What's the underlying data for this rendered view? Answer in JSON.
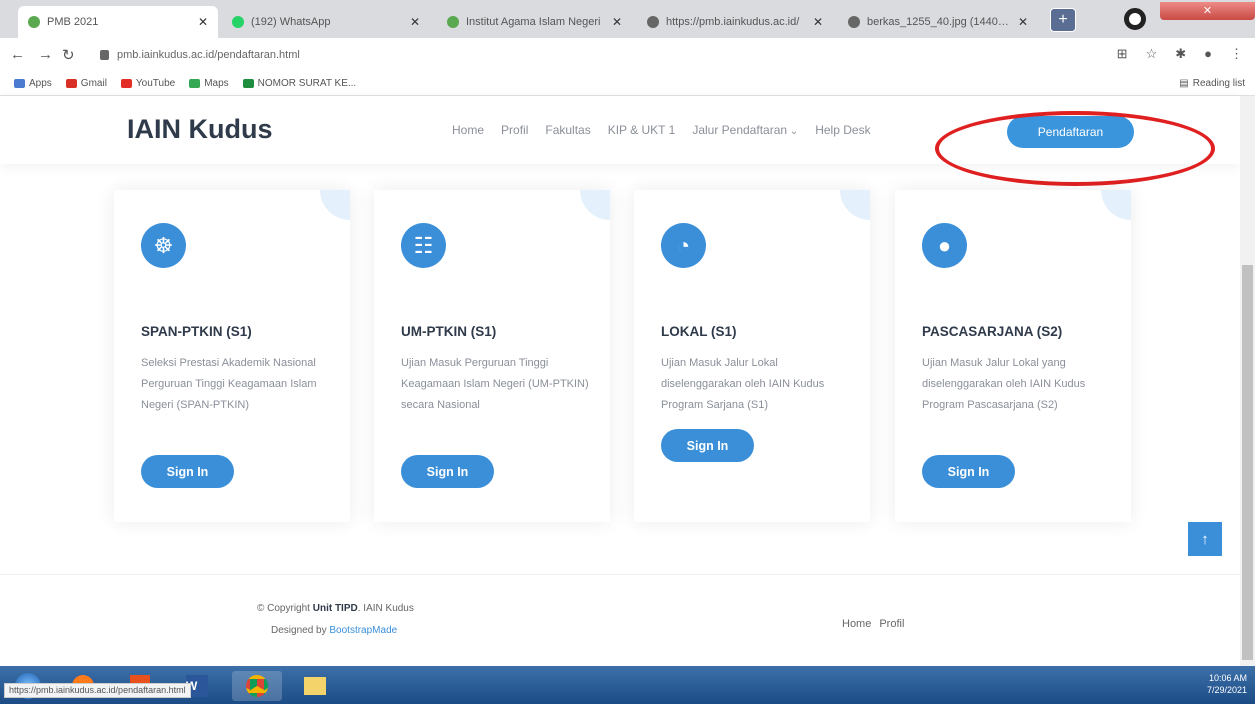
{
  "browser": {
    "tabs": [
      {
        "title": "PMB 2021",
        "active": true,
        "color": "#5aa84f"
      },
      {
        "title": "(192) WhatsApp",
        "active": false,
        "color": "#25d366"
      },
      {
        "title": "Institut Agama Islam Negeri",
        "active": false,
        "color": "#5aa84f"
      },
      {
        "title": "https://pmb.iainkudus.ac.id/",
        "active": false,
        "color": "#666666"
      },
      {
        "title": "berkas_1255_40.jpg (1440×8",
        "active": false,
        "color": "#666666"
      }
    ],
    "url": "pmb.iainkudus.ac.id/pendaftaran.html",
    "bookmarks": [
      {
        "label": "Apps",
        "color": "#4a7bd0"
      },
      {
        "label": "Gmail",
        "color": "#d93025"
      },
      {
        "label": "YouTube",
        "color": "#e52d27"
      },
      {
        "label": "Maps",
        "color": "#34a853"
      },
      {
        "label": "NOMOR SURAT KE...",
        "color": "#1e8e3e"
      }
    ],
    "reading_list": "Reading list",
    "status_url": "https://pmb.iainkudus.ac.id/pendaftaran.html"
  },
  "site": {
    "logo": "IAIN Kudus",
    "nav": [
      "Home",
      "Profil",
      "Fakultas",
      "KIP & UKT 1",
      "Jalur Pendaftaran",
      "Help Desk"
    ],
    "cta": "Pendaftaran",
    "accent": "#3a8fd8"
  },
  "cards": [
    {
      "icon": "dribbble-icon",
      "glyph": "☸",
      "title": "SPAN-PTKIN (S1)",
      "desc": "Seleksi Prestasi Akademik Nasional Perguruan Tinggi Keagamaan Islam Negeri (SPAN-PTKIN)",
      "button": "Sign In"
    },
    {
      "icon": "file-text-icon",
      "glyph": "☷",
      "title": "UM-PTKIN (S1)",
      "desc": "Ujian Masuk Perguruan Tinggi Keagamaan Islam Negeri (UM-PTKIN) secara Nasional",
      "button": "Sign In"
    },
    {
      "icon": "speedometer-icon",
      "glyph": "◔",
      "title": "LOKAL (S1)",
      "desc": "Ujian Masuk Jalur Lokal diselenggarakan oleh IAIN Kudus Program Sarjana (S1)",
      "button": "Sign In"
    },
    {
      "icon": "globe-icon",
      "glyph": "●",
      "title": "PASCASARJANA (S2)",
      "desc": "Ujian Masuk Jalur Lokal yang diselenggarakan oleh IAIN Kudus Program Pascasarjana (S2)",
      "button": "Sign In"
    }
  ],
  "footer": {
    "copyright_prefix": "© Copyright",
    "copyright_bold": "Unit TIPD",
    "copyright_suffix": ". IAIN Kudus",
    "designed_prefix": "Designed by",
    "designed_link": "BootstrapMade",
    "links": [
      "Home",
      "Profil"
    ]
  },
  "taskbar": {
    "time": "10:06 AM",
    "date": "7/29/2021"
  }
}
